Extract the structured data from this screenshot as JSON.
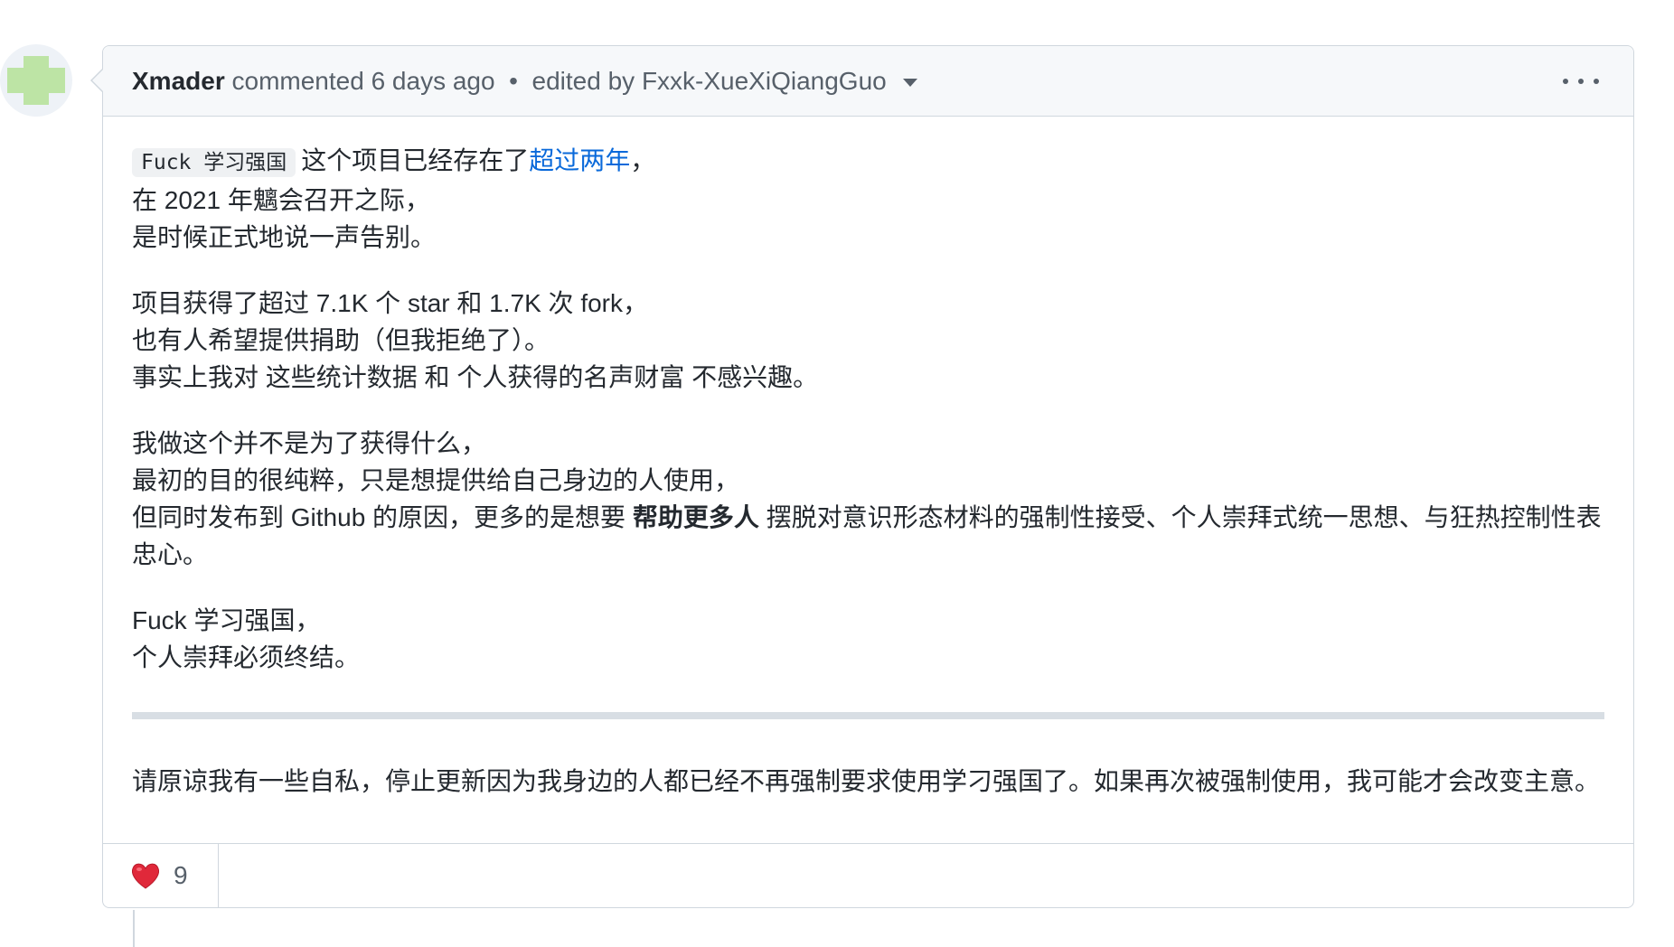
{
  "comment": {
    "author": "Xmader",
    "action": "commented",
    "time": "6 days ago",
    "separator": "•",
    "edited_label": "edited by",
    "editor": "Fxxk-XueXiQiangGuo",
    "body": {
      "p1": {
        "code": "Fuck 学习强国",
        "text_before_link": "这个项目已经存在了",
        "link": "超过两年",
        "after_link": "，",
        "line2": "在 2021 年魑会召开之际，",
        "line3": "是时候正式地说一声告别。"
      },
      "p2": {
        "line1": "项目获得了超过 7.1K 个 star 和 1.7K 次 fork，",
        "line2": "也有人希望提供捐助（但我拒绝了）。",
        "line3": "事实上我对 这些统计数据 和 个人获得的名声财富 不感兴趣。"
      },
      "p3": {
        "line1": "我做这个并不是为了获得什么，",
        "line2": "最初的目的很纯粹，只是想提供给自己身边的人使用，",
        "line3_before": "但同时发布到 Github 的原因，更多的是想要 ",
        "line3_strong": "帮助更多人",
        "line3_after": " 摆脱对意识形态材料的强制性接受、个人崇拜式统一思想、与狂热控制性表忠心。"
      },
      "p4": {
        "line1": "Fuck 学习强国，",
        "line2": "个人崇拜必须终结。"
      },
      "p5": "请原谅我有一些自私，停止更新因为我身边的人都已经不再强制要求使用学刁强国了。如果再次被强制使用，我可能才会改变主意。"
    },
    "reactions": [
      {
        "icon": "heart-icon",
        "count": "9",
        "color": "#d1242f"
      }
    ]
  }
}
